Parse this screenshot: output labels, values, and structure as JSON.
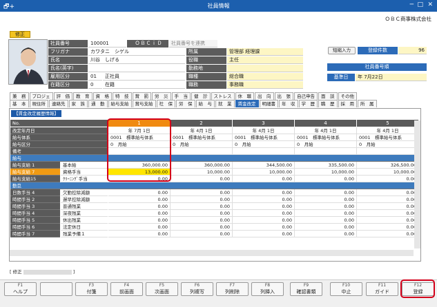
{
  "window": {
    "title": "社員情報",
    "icon": "🗗+"
  },
  "company": "ＯＢＣ商事株式会社",
  "mode_badge": "修正",
  "employee": {
    "labels": {
      "code": "社員番号",
      "kana": "フリガナ",
      "name": "氏名",
      "name_en": "氏名(英字)",
      "emp_type": "雇用区分",
      "status": "在籍区分",
      "dept": "所属",
      "position": "役職",
      "workplace": "勤務地",
      "job": "職種",
      "job_class": "職務"
    },
    "code": "100001",
    "obcid_label": "ＯＢＣｉＤ",
    "obcid_link": "社員番号を連携",
    "kana": "カワタニ　シゲル",
    "name": "川谷　しげる",
    "name_en": "",
    "emp_type_code": "01",
    "emp_type": "正社員",
    "status_code": "0",
    "status": "在籍",
    "dept": "管理部 経理課",
    "position": "主任",
    "workplace": "",
    "job": "総合職",
    "job_class": "事務職"
  },
  "right_panel": {
    "short_input": "短縮入力",
    "reg_count_label": "登録件数",
    "reg_count": "96",
    "order_label": "社員番号順",
    "base_date_label": "基準日",
    "base_date": "年  7月22日"
  },
  "tabs_row1": [
    "兼　務",
    "プロジェ",
    "評　価",
    "教　育",
    "資　格",
    "特　技",
    "賞　罰",
    "労　災",
    "手　当",
    "健　診",
    "ストレス",
    "休　職",
    "出　向",
    "出　張",
    "自己申告",
    "面　談",
    "その他"
  ],
  "tabs_row2": [
    "基　本",
    "現住所",
    "連絡先",
    "家　族",
    "通　勤",
    "給与支給",
    "賞与支給",
    "社　保",
    "労　保",
    "給　与",
    "就　業",
    "賃金改定",
    "明細書",
    "年　収",
    "学　歴",
    "職　歴",
    "採　用",
    "所　属"
  ],
  "active_tab": "賃金改定",
  "panel_title": "【賃金改定履歴情報】",
  "grid": {
    "no_label": "No.",
    "columns": [
      "1",
      "2",
      "3",
      "4",
      "5"
    ],
    "rows_top": [
      {
        "label": "改定年月日",
        "cells": [
          "年  7月  1日",
          "年  4月  1日",
          "年  4月  1日",
          "年  4月  1日",
          "年  4月  1日"
        ]
      },
      {
        "label": "給与体系",
        "cells": [
          "0001　標準給与体系",
          "0001　標準給与体系",
          "0001　標準給与体系",
          "0001　標準給与体系",
          "0001　標準給与体系"
        ]
      },
      {
        "label": "給与区分",
        "cells": [
          "0　月給",
          "0　月給",
          "0　月給",
          "0　月給",
          "0　月給"
        ]
      },
      {
        "label": "備考",
        "cells": [
          "",
          "",
          "",
          "",
          ""
        ]
      }
    ],
    "section_salary": "給与",
    "rows_salary": [
      {
        "label": "給与支給 1",
        "sub": "基本給",
        "cells": [
          "360,000.00",
          "360,000.00",
          "344,500.00",
          "335,500.00",
          "326,500.00"
        ]
      },
      {
        "label": "給与支給 7",
        "sub": "資格手当",
        "cells": [
          "13,000.00",
          "10,000.00",
          "10,000.00",
          "10,000.00",
          "10,000.00"
        ]
      },
      {
        "label": "給与支給15",
        "sub": "ｸﾘｰﾆﾝｸﾞ手当",
        "cells": [
          "0.00",
          "0.00",
          "0.00",
          "0.00",
          "0.00"
        ]
      }
    ],
    "section_attendance": "勤怠",
    "rows_att": [
      {
        "label": "日数手当 4",
        "sub": "欠勤控除減額",
        "cells": [
          "0.00",
          "0.00",
          "0.00",
          "0.00",
          "0.00"
        ]
      },
      {
        "label": "時間手当 2",
        "sub": "遅早控除減額",
        "cells": [
          "0.00",
          "0.00",
          "0.00",
          "0.00",
          "0.00"
        ]
      },
      {
        "label": "時間手当 3",
        "sub": "普通残業",
        "cells": [
          "0.00",
          "0.00",
          "0.00",
          "0.00",
          "0.00"
        ]
      },
      {
        "label": "時間手当 4",
        "sub": "深夜残業",
        "cells": [
          "0.00",
          "0.00",
          "0.00",
          "0.00",
          "0.00"
        ]
      },
      {
        "label": "時間手当 5",
        "sub": "休出残業",
        "cells": [
          "0.00",
          "0.00",
          "0.00",
          "0.00",
          "0.00"
        ]
      },
      {
        "label": "時間手当 6",
        "sub": "法定休日",
        "cells": [
          "0.00",
          "0.00",
          "0.00",
          "0.00",
          "0.00"
        ]
      },
      {
        "label": "時間手当 7",
        "sub": "残業予備１",
        "cells": [
          "0.00",
          "0.00",
          "0.00",
          "0.00",
          "0.00"
        ]
      }
    ]
  },
  "status_mode": "[ 修正",
  "fkeys": [
    {
      "key": "F1",
      "label": "ヘルプ"
    },
    {
      "key": "",
      "label": ""
    },
    {
      "key": "F3",
      "label": "付箋"
    },
    {
      "key": "F4",
      "label": "前画面"
    },
    {
      "key": "F5",
      "label": "次画面"
    },
    {
      "key": "F6",
      "label": "列複写"
    },
    {
      "key": "F7",
      "label": "列削除"
    },
    {
      "key": "F8",
      "label": "列挿入"
    },
    {
      "key": "F9",
      "label": "確認書類"
    },
    {
      "key": "F10",
      "label": "中止"
    },
    {
      "key": "F11",
      "label": "ガイド"
    },
    {
      "key": "F12",
      "label": "登録"
    }
  ],
  "colors": {
    "titlebar": "#1c5fae",
    "accent_orange": "#f08a10",
    "highlight_red": "#d4001a",
    "section_blue": "#3e7bbd"
  }
}
